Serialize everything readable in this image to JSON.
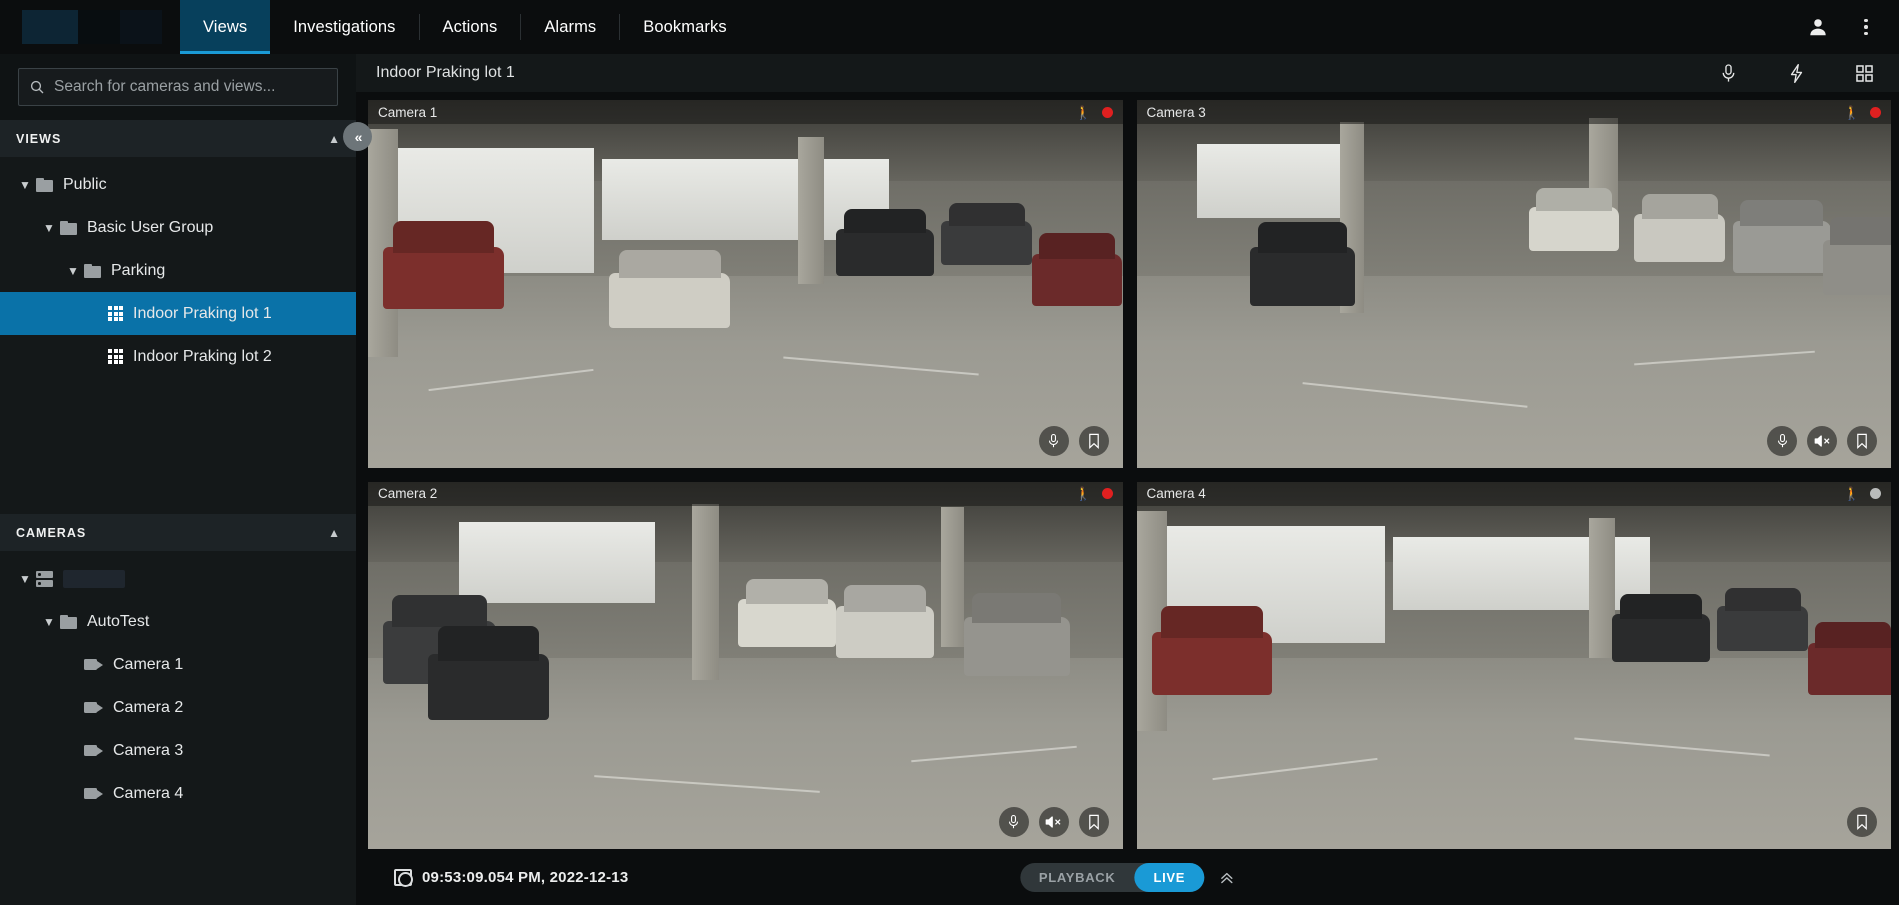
{
  "app": {
    "logo_label": "",
    "accent": "#1a9ad6",
    "selected_bg": "#0a72a8"
  },
  "topnav": {
    "items": [
      {
        "label": "Views",
        "active": true
      },
      {
        "label": "Investigations",
        "active": false
      },
      {
        "label": "Actions",
        "active": false
      },
      {
        "label": "Alarms",
        "active": false
      },
      {
        "label": "Bookmarks",
        "active": false
      }
    ],
    "user_icon": "user-icon",
    "more_icon": "kebab-menu-icon"
  },
  "search": {
    "placeholder": "Search for cameras and views...",
    "value": "",
    "icon": "search-icon"
  },
  "sidebar": {
    "collapse_icon": "double-chevron-left-icon",
    "views": {
      "title": "VIEWS",
      "collapse_icon": "chevron-up-icon",
      "tree": [
        {
          "label": "Public",
          "icon": "folder-icon",
          "depth": 0,
          "expanded": true,
          "selected": false
        },
        {
          "label": "Basic User Group",
          "icon": "folder-icon",
          "depth": 1,
          "expanded": true,
          "selected": false
        },
        {
          "label": "Parking",
          "icon": "folder-icon",
          "depth": 2,
          "expanded": true,
          "selected": false
        },
        {
          "label": "Indoor Praking lot 1",
          "icon": "view-grid-icon",
          "depth": 3,
          "expanded": null,
          "selected": true
        },
        {
          "label": "Indoor Praking lot 2",
          "icon": "view-grid-icon",
          "depth": 3,
          "expanded": null,
          "selected": false
        }
      ]
    },
    "cameras": {
      "title": "CAMERAS",
      "collapse_icon": "chevron-up-icon",
      "tree": [
        {
          "label": "",
          "icon": "server-icon",
          "depth": 0,
          "expanded": true,
          "redacted": true
        },
        {
          "label": "AutoTest",
          "icon": "folder-icon",
          "depth": 1,
          "expanded": true,
          "redacted": false
        },
        {
          "label": "Camera 1",
          "icon": "camera-icon",
          "depth": 2,
          "expanded": null,
          "redacted": false
        },
        {
          "label": "Camera 2",
          "icon": "camera-icon",
          "depth": 2,
          "expanded": null,
          "redacted": false
        },
        {
          "label": "Camera 3",
          "icon": "camera-icon",
          "depth": 2,
          "expanded": null,
          "redacted": false
        },
        {
          "label": "Camera 4",
          "icon": "camera-icon",
          "depth": 2,
          "expanded": null,
          "redacted": false
        }
      ]
    }
  },
  "view": {
    "title": "Indoor Praking lot 1",
    "header_icons": [
      {
        "name": "microphone-icon"
      },
      {
        "name": "lightning-bolt-icon"
      },
      {
        "name": "layout-grid-icon"
      }
    ]
  },
  "tiles": [
    {
      "name": "Camera 1",
      "recording": true,
      "motion_color": "#e02020",
      "dot_color": "#e02020",
      "actions": [
        "microphone-icon",
        "bookmark-icon"
      ]
    },
    {
      "name": "Camera 3",
      "recording": true,
      "motion_color": "#e02020",
      "dot_color": "#e02020",
      "actions": [
        "microphone-icon",
        "speaker-muted-icon",
        "bookmark-icon"
      ]
    },
    {
      "name": "Camera 2",
      "recording": true,
      "motion_color": "#e02020",
      "dot_color": "#e02020",
      "actions": [
        "microphone-icon",
        "speaker-muted-icon",
        "bookmark-icon"
      ]
    },
    {
      "name": "Camera 4",
      "recording": false,
      "motion_color": "#b9bbba",
      "dot_color": "#b9bbba",
      "actions": [
        "bookmark-icon"
      ]
    }
  ],
  "bottom": {
    "timestamp": "09:53:09.054 PM, 2022-12-13",
    "clock_icon": "timestamp-icon",
    "modes": [
      {
        "label": "PLAYBACK",
        "active": false
      },
      {
        "label": "LIVE",
        "active": true
      }
    ],
    "expand_icon": "double-chevron-up-icon"
  }
}
